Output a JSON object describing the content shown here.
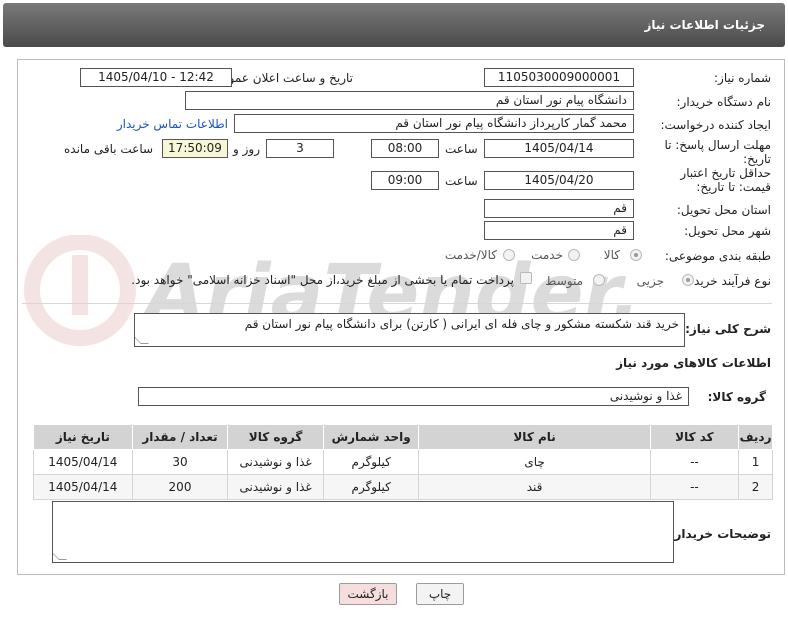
{
  "header": {
    "title": "جزئیات اطلاعات نیاز"
  },
  "watermark": {
    "text": "AriaTender.net"
  },
  "fields": {
    "need_number": {
      "label": "شماره نیاز:",
      "value": "1105030009000001"
    },
    "announce": {
      "label": "تاریخ و ساعت اعلان عمومی:",
      "value": "1405/04/10 - 12:42"
    },
    "buyer_org": {
      "label": "نام دستگاه خریدار:",
      "value": "دانشگاه پیام نور استان قم"
    },
    "requester": {
      "label": "ایجاد کننده درخواست:",
      "value": "محمد گمار کارپرداز دانشگاه پیام نور استان قم",
      "contact_link": "اطلاعات تماس خریدار"
    },
    "reply_deadline": {
      "label": "مهلت ارسال پاسخ: تا تاریخ:",
      "date": "1405/04/14",
      "time_label": "ساعت",
      "time": "08:00",
      "days": "3",
      "days_label": "روز و",
      "remaining": "17:50:09",
      "remaining_label": "ساعت باقی مانده"
    },
    "price_validity": {
      "label": "حداقل تاریخ اعتبار قیمت: تا تاریخ:",
      "date": "1405/04/20",
      "time_label": "ساعت",
      "time": "09:00"
    },
    "delivery_province": {
      "label": "استان محل تحویل:",
      "value": "قم"
    },
    "delivery_city": {
      "label": "شهر محل تحویل:",
      "value": "قم"
    },
    "category": {
      "label": "طبقه بندی موضوعی:",
      "options": [
        "کالا",
        "خدمت",
        "کالا/خدمت"
      ]
    },
    "process": {
      "label": "نوع فرآیند خرید :",
      "options": [
        "جزیی",
        "متوسط"
      ],
      "payment_note": "پرداخت تمام یا بخشی از مبلغ خرید،از محل \"اسناد خزانه اسلامی\" خواهد بود."
    },
    "summary": {
      "label": "شرح کلی نیاز:",
      "value": "خرید قند شکسته مشکور و چای فله ای ایرانی  ( کارتن) برای دانشگاه پیام نور استان قم"
    }
  },
  "goods": {
    "section_title": "اطلاعات کالاهای مورد نیاز",
    "group_label": "گروه کالا:",
    "group_value": "غذا و نوشیدنی",
    "columns": [
      "ردیف",
      "کد کالا",
      "نام کالا",
      "واحد شمارش",
      "گروه کالا",
      "تعداد / مقدار",
      "تاریخ نیاز"
    ],
    "rows": [
      [
        "1",
        "--",
        "چای",
        "کیلوگرم",
        "غذا و نوشیدنی",
        "30",
        "1405/04/14"
      ],
      [
        "2",
        "--",
        "قند",
        "کیلوگرم",
        "غذا و نوشیدنی",
        "200",
        "1405/04/14"
      ]
    ]
  },
  "buyer_notes": {
    "label": "توضیحات خریدار:",
    "value": ""
  },
  "buttons": {
    "print": "چاپ",
    "back": "بازگشت"
  }
}
